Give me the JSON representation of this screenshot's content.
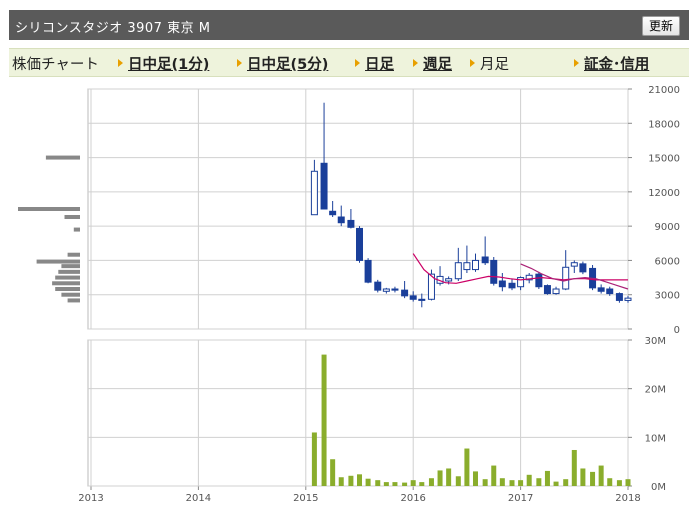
{
  "header": {
    "title": "シリコンスタジオ 3907 東京 M",
    "refresh_label": "更新"
  },
  "tabs": [
    {
      "label": "株価チャート",
      "link": false,
      "arrow": false
    },
    {
      "label": "日中足(1分)",
      "link": true,
      "arrow": true
    },
    {
      "label": "日中足(5分)",
      "link": true,
      "arrow": true
    },
    {
      "label": "日足",
      "link": true,
      "arrow": true
    },
    {
      "label": "週足",
      "link": true,
      "arrow": true
    },
    {
      "label": "月足",
      "link": false,
      "arrow": true
    },
    {
      "label": "証金･信用",
      "link": true,
      "arrow": true
    }
  ],
  "colors": {
    "up_candle": "#ffffff",
    "down_candle": "#1a3f9a",
    "candle_outline": "#1a3f9a",
    "ma_short": "#cc0066",
    "ma_long": "#aa2277",
    "volume_bar": "#8aad2c",
    "price_profile": "#888888",
    "grid": "#d0d0d0"
  },
  "chart_data": [
    {
      "type": "candlestick",
      "title": "",
      "x_ticks": [
        "2013",
        "2014",
        "2015",
        "2016",
        "2017",
        "2018"
      ],
      "ylim": [
        0,
        21000
      ],
      "y_ticks": [
        "0",
        "3000",
        "6000",
        "9000",
        "12000",
        "15000",
        "18000",
        "21000"
      ],
      "candles": [
        {
          "t": 2015.08,
          "open": 10000,
          "high": 14800,
          "low": 10000,
          "close": 13800
        },
        {
          "t": 2015.17,
          "open": 14500,
          "high": 19800,
          "low": 10500,
          "close": 10500
        },
        {
          "t": 2015.25,
          "open": 10300,
          "high": 11200,
          "low": 9800,
          "close": 10000
        },
        {
          "t": 2015.33,
          "open": 9800,
          "high": 10800,
          "low": 9000,
          "close": 9300
        },
        {
          "t": 2015.42,
          "open": 9500,
          "high": 10500,
          "low": 8800,
          "close": 8900
        },
        {
          "t": 2015.5,
          "open": 8800,
          "high": 9000,
          "low": 5800,
          "close": 6000
        },
        {
          "t": 2015.58,
          "open": 6000,
          "high": 6200,
          "low": 4000,
          "close": 4100
        },
        {
          "t": 2015.67,
          "open": 4100,
          "high": 4300,
          "low": 3200,
          "close": 3400
        },
        {
          "t": 2015.75,
          "open": 3300,
          "high": 3600,
          "low": 3100,
          "close": 3500
        },
        {
          "t": 2015.83,
          "open": 3500,
          "high": 3700,
          "low": 3200,
          "close": 3400
        },
        {
          "t": 2015.92,
          "open": 3400,
          "high": 4200,
          "low": 2700,
          "close": 2900
        },
        {
          "t": 2016.0,
          "open": 2900,
          "high": 3300,
          "low": 2400,
          "close": 2600
        },
        {
          "t": 2016.08,
          "open": 2600,
          "high": 3100,
          "low": 1900,
          "close": 2500
        },
        {
          "t": 2016.17,
          "open": 2600,
          "high": 5200,
          "low": 2500,
          "close": 4800
        },
        {
          "t": 2016.25,
          "open": 4000,
          "high": 5500,
          "low": 3800,
          "close": 4600
        },
        {
          "t": 2016.33,
          "open": 4200,
          "high": 4600,
          "low": 3900,
          "close": 4400
        },
        {
          "t": 2016.42,
          "open": 4400,
          "high": 7100,
          "low": 4200,
          "close": 5800
        },
        {
          "t": 2016.5,
          "open": 5200,
          "high": 7300,
          "low": 4900,
          "close": 5800
        },
        {
          "t": 2016.58,
          "open": 5200,
          "high": 6600,
          "low": 5000,
          "close": 6000
        },
        {
          "t": 2016.67,
          "open": 6300,
          "high": 8100,
          "low": 5600,
          "close": 5800
        },
        {
          "t": 2016.75,
          "open": 6000,
          "high": 6300,
          "low": 3800,
          "close": 4000
        },
        {
          "t": 2016.83,
          "open": 4200,
          "high": 4900,
          "low": 3300,
          "close": 3700
        },
        {
          "t": 2016.92,
          "open": 4000,
          "high": 4400,
          "low": 3400,
          "close": 3600
        },
        {
          "t": 2017.0,
          "open": 3700,
          "high": 4600,
          "low": 3400,
          "close": 4500
        },
        {
          "t": 2017.08,
          "open": 4300,
          "high": 4900,
          "low": 4000,
          "close": 4700
        },
        {
          "t": 2017.17,
          "open": 4800,
          "high": 5000,
          "low": 3500,
          "close": 3700
        },
        {
          "t": 2017.25,
          "open": 3800,
          "high": 3900,
          "low": 3000,
          "close": 3100
        },
        {
          "t": 2017.33,
          "open": 3100,
          "high": 3700,
          "low": 3000,
          "close": 3500
        },
        {
          "t": 2017.42,
          "open": 3500,
          "high": 6900,
          "low": 3400,
          "close": 5400
        },
        {
          "t": 2017.5,
          "open": 5500,
          "high": 6000,
          "low": 4900,
          "close": 5800
        },
        {
          "t": 2017.58,
          "open": 5700,
          "high": 5900,
          "low": 4800,
          "close": 5000
        },
        {
          "t": 2017.67,
          "open": 5300,
          "high": 5600,
          "low": 3400,
          "close": 3600
        },
        {
          "t": 2017.75,
          "open": 3600,
          "high": 3900,
          "low": 3100,
          "close": 3300
        },
        {
          "t": 2017.83,
          "open": 3500,
          "high": 3700,
          "low": 2900,
          "close": 3100
        },
        {
          "t": 2017.92,
          "open": 3100,
          "high": 3200,
          "low": 2300,
          "close": 2500
        },
        {
          "t": 2018.0,
          "open": 2500,
          "high": 2900,
          "low": 2300,
          "close": 2700
        }
      ],
      "moving_averages": [
        {
          "points": [
            [
              2016.0,
              6600
            ],
            [
              2016.1,
              5200
            ],
            [
              2016.2,
              4400
            ],
            [
              2016.3,
              4050
            ],
            [
              2016.4,
              4000
            ],
            [
              2016.5,
              4200
            ],
            [
              2016.6,
              4400
            ],
            [
              2016.7,
              4600
            ],
            [
              2016.8,
              4550
            ],
            [
              2016.9,
              4400
            ],
            [
              2017.0,
              4300
            ],
            [
              2017.1,
              4400
            ],
            [
              2017.2,
              4500
            ],
            [
              2017.3,
              4400
            ],
            [
              2017.4,
              4300
            ],
            [
              2017.5,
              4400
            ],
            [
              2017.6,
              4400
            ],
            [
              2017.7,
              4300
            ],
            [
              2017.8,
              4300
            ],
            [
              2018.0,
              4300
            ]
          ]
        },
        {
          "points": [
            [
              2017.0,
              5700
            ],
            [
              2017.1,
              5300
            ],
            [
              2017.2,
              4800
            ],
            [
              2017.3,
              4400
            ],
            [
              2017.4,
              4200
            ],
            [
              2017.5,
              4400
            ],
            [
              2017.6,
              4500
            ],
            [
              2017.7,
              4400
            ],
            [
              2017.8,
              4100
            ],
            [
              2017.9,
              3800
            ],
            [
              2018.0,
              3500
            ]
          ]
        }
      ],
      "price_volume_profile": [
        {
          "price": 15000,
          "weight": 0.55
        },
        {
          "price": 10500,
          "weight": 1.0
        },
        {
          "price": 9800,
          "weight": 0.25
        },
        {
          "price": 8700,
          "weight": 0.1
        },
        {
          "price": 6500,
          "weight": 0.2
        },
        {
          "price": 5900,
          "weight": 0.7
        },
        {
          "price": 5500,
          "weight": 0.3
        },
        {
          "price": 5000,
          "weight": 0.35
        },
        {
          "price": 4500,
          "weight": 0.4
        },
        {
          "price": 4000,
          "weight": 0.45
        },
        {
          "price": 3500,
          "weight": 0.4
        },
        {
          "price": 3000,
          "weight": 0.3
        },
        {
          "price": 2500,
          "weight": 0.2
        }
      ]
    },
    {
      "type": "bar",
      "title": "",
      "x_ticks": [
        "2013",
        "2014",
        "2015",
        "2016",
        "2017",
        "2018"
      ],
      "ylim": [
        0,
        30
      ],
      "y_unit": "M",
      "y_ticks": [
        "0M",
        "10M",
        "20M",
        "30M"
      ],
      "bars": [
        {
          "t": 2015.08,
          "value": 11
        },
        {
          "t": 2015.17,
          "value": 27
        },
        {
          "t": 2015.25,
          "value": 5.5
        },
        {
          "t": 2015.33,
          "value": 1.8
        },
        {
          "t": 2015.42,
          "value": 2.1
        },
        {
          "t": 2015.5,
          "value": 2.4
        },
        {
          "t": 2015.58,
          "value": 1.5
        },
        {
          "t": 2015.67,
          "value": 1.2
        },
        {
          "t": 2015.75,
          "value": 0.8
        },
        {
          "t": 2015.83,
          "value": 0.8
        },
        {
          "t": 2015.92,
          "value": 0.7
        },
        {
          "t": 2016.0,
          "value": 1.2
        },
        {
          "t": 2016.08,
          "value": 0.8
        },
        {
          "t": 2016.17,
          "value": 1.6
        },
        {
          "t": 2016.25,
          "value": 3.2
        },
        {
          "t": 2016.33,
          "value": 3.6
        },
        {
          "t": 2016.42,
          "value": 2.0
        },
        {
          "t": 2016.5,
          "value": 7.7
        },
        {
          "t": 2016.58,
          "value": 3.0
        },
        {
          "t": 2016.67,
          "value": 1.4
        },
        {
          "t": 2016.75,
          "value": 4.2
        },
        {
          "t": 2016.83,
          "value": 1.6
        },
        {
          "t": 2016.92,
          "value": 1.2
        },
        {
          "t": 2017.0,
          "value": 1.2
        },
        {
          "t": 2017.08,
          "value": 2.3
        },
        {
          "t": 2017.17,
          "value": 1.6
        },
        {
          "t": 2017.25,
          "value": 3.1
        },
        {
          "t": 2017.33,
          "value": 0.9
        },
        {
          "t": 2017.42,
          "value": 1.4
        },
        {
          "t": 2017.5,
          "value": 7.4
        },
        {
          "t": 2017.58,
          "value": 3.6
        },
        {
          "t": 2017.67,
          "value": 2.9
        },
        {
          "t": 2017.75,
          "value": 4.2
        },
        {
          "t": 2017.83,
          "value": 1.6
        },
        {
          "t": 2017.92,
          "value": 1.2
        },
        {
          "t": 2018.0,
          "value": 1.4
        }
      ]
    }
  ]
}
